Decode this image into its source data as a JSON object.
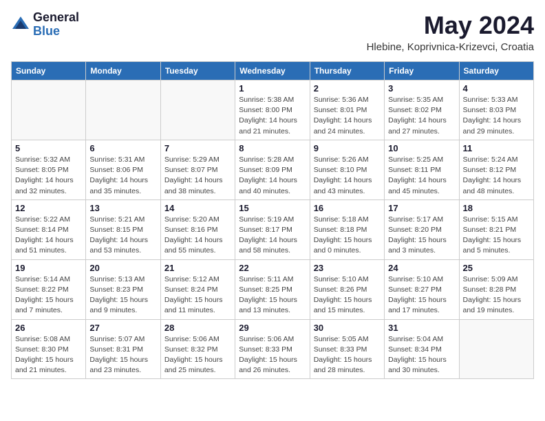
{
  "logo": {
    "general": "General",
    "blue": "Blue"
  },
  "title": "May 2024",
  "location": "Hlebine, Koprivnica-Krizevci, Croatia",
  "headers": [
    "Sunday",
    "Monday",
    "Tuesday",
    "Wednesday",
    "Thursday",
    "Friday",
    "Saturday"
  ],
  "weeks": [
    [
      {
        "day": "",
        "info": ""
      },
      {
        "day": "",
        "info": ""
      },
      {
        "day": "",
        "info": ""
      },
      {
        "day": "1",
        "info": "Sunrise: 5:38 AM\nSunset: 8:00 PM\nDaylight: 14 hours\nand 21 minutes."
      },
      {
        "day": "2",
        "info": "Sunrise: 5:36 AM\nSunset: 8:01 PM\nDaylight: 14 hours\nand 24 minutes."
      },
      {
        "day": "3",
        "info": "Sunrise: 5:35 AM\nSunset: 8:02 PM\nDaylight: 14 hours\nand 27 minutes."
      },
      {
        "day": "4",
        "info": "Sunrise: 5:33 AM\nSunset: 8:03 PM\nDaylight: 14 hours\nand 29 minutes."
      }
    ],
    [
      {
        "day": "5",
        "info": "Sunrise: 5:32 AM\nSunset: 8:05 PM\nDaylight: 14 hours\nand 32 minutes."
      },
      {
        "day": "6",
        "info": "Sunrise: 5:31 AM\nSunset: 8:06 PM\nDaylight: 14 hours\nand 35 minutes."
      },
      {
        "day": "7",
        "info": "Sunrise: 5:29 AM\nSunset: 8:07 PM\nDaylight: 14 hours\nand 38 minutes."
      },
      {
        "day": "8",
        "info": "Sunrise: 5:28 AM\nSunset: 8:09 PM\nDaylight: 14 hours\nand 40 minutes."
      },
      {
        "day": "9",
        "info": "Sunrise: 5:26 AM\nSunset: 8:10 PM\nDaylight: 14 hours\nand 43 minutes."
      },
      {
        "day": "10",
        "info": "Sunrise: 5:25 AM\nSunset: 8:11 PM\nDaylight: 14 hours\nand 45 minutes."
      },
      {
        "day": "11",
        "info": "Sunrise: 5:24 AM\nSunset: 8:12 PM\nDaylight: 14 hours\nand 48 minutes."
      }
    ],
    [
      {
        "day": "12",
        "info": "Sunrise: 5:22 AM\nSunset: 8:14 PM\nDaylight: 14 hours\nand 51 minutes."
      },
      {
        "day": "13",
        "info": "Sunrise: 5:21 AM\nSunset: 8:15 PM\nDaylight: 14 hours\nand 53 minutes."
      },
      {
        "day": "14",
        "info": "Sunrise: 5:20 AM\nSunset: 8:16 PM\nDaylight: 14 hours\nand 55 minutes."
      },
      {
        "day": "15",
        "info": "Sunrise: 5:19 AM\nSunset: 8:17 PM\nDaylight: 14 hours\nand 58 minutes."
      },
      {
        "day": "16",
        "info": "Sunrise: 5:18 AM\nSunset: 8:18 PM\nDaylight: 15 hours\nand 0 minutes."
      },
      {
        "day": "17",
        "info": "Sunrise: 5:17 AM\nSunset: 8:20 PM\nDaylight: 15 hours\nand 3 minutes."
      },
      {
        "day": "18",
        "info": "Sunrise: 5:15 AM\nSunset: 8:21 PM\nDaylight: 15 hours\nand 5 minutes."
      }
    ],
    [
      {
        "day": "19",
        "info": "Sunrise: 5:14 AM\nSunset: 8:22 PM\nDaylight: 15 hours\nand 7 minutes."
      },
      {
        "day": "20",
        "info": "Sunrise: 5:13 AM\nSunset: 8:23 PM\nDaylight: 15 hours\nand 9 minutes."
      },
      {
        "day": "21",
        "info": "Sunrise: 5:12 AM\nSunset: 8:24 PM\nDaylight: 15 hours\nand 11 minutes."
      },
      {
        "day": "22",
        "info": "Sunrise: 5:11 AM\nSunset: 8:25 PM\nDaylight: 15 hours\nand 13 minutes."
      },
      {
        "day": "23",
        "info": "Sunrise: 5:10 AM\nSunset: 8:26 PM\nDaylight: 15 hours\nand 15 minutes."
      },
      {
        "day": "24",
        "info": "Sunrise: 5:10 AM\nSunset: 8:27 PM\nDaylight: 15 hours\nand 17 minutes."
      },
      {
        "day": "25",
        "info": "Sunrise: 5:09 AM\nSunset: 8:28 PM\nDaylight: 15 hours\nand 19 minutes."
      }
    ],
    [
      {
        "day": "26",
        "info": "Sunrise: 5:08 AM\nSunset: 8:30 PM\nDaylight: 15 hours\nand 21 minutes."
      },
      {
        "day": "27",
        "info": "Sunrise: 5:07 AM\nSunset: 8:31 PM\nDaylight: 15 hours\nand 23 minutes."
      },
      {
        "day": "28",
        "info": "Sunrise: 5:06 AM\nSunset: 8:32 PM\nDaylight: 15 hours\nand 25 minutes."
      },
      {
        "day": "29",
        "info": "Sunrise: 5:06 AM\nSunset: 8:33 PM\nDaylight: 15 hours\nand 26 minutes."
      },
      {
        "day": "30",
        "info": "Sunrise: 5:05 AM\nSunset: 8:33 PM\nDaylight: 15 hours\nand 28 minutes."
      },
      {
        "day": "31",
        "info": "Sunrise: 5:04 AM\nSunset: 8:34 PM\nDaylight: 15 hours\nand 30 minutes."
      },
      {
        "day": "",
        "info": ""
      }
    ]
  ]
}
